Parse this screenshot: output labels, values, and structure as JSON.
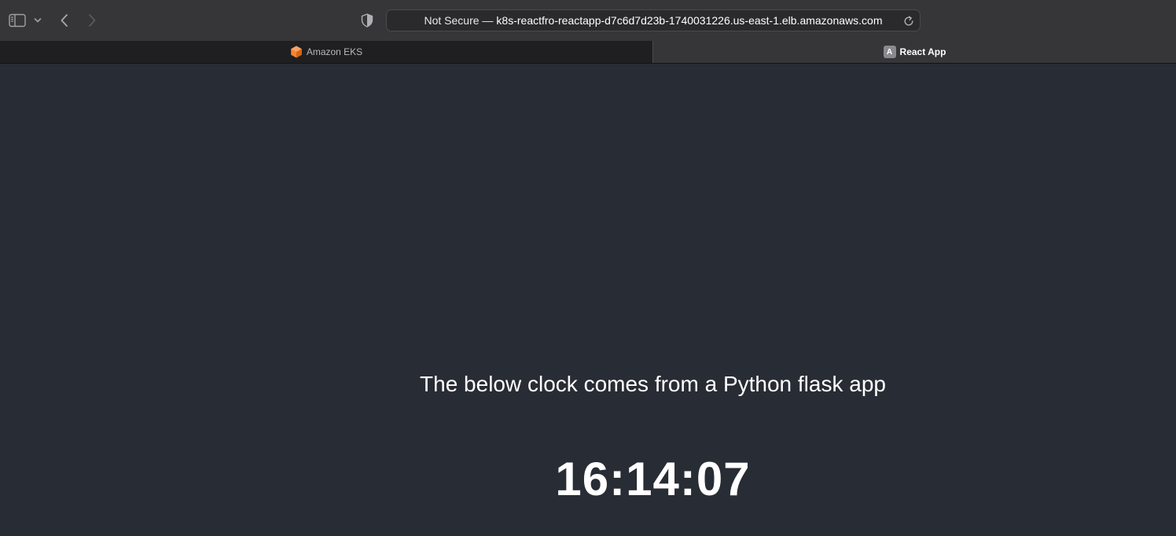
{
  "browser": {
    "address_bar": {
      "security_label": "Not Secure —",
      "url": "k8s-reactfro-reactapp-d7c6d7d23b-1740031226.us-east-1.elb.amazonaws.com"
    },
    "tabs": [
      {
        "title": "Amazon EKS",
        "icon": "aws-eks-icon",
        "active": false
      },
      {
        "title": "React App",
        "icon": "react-app-favicon",
        "favicon_letter": "A",
        "active": true
      }
    ],
    "icons": {
      "sidebar": "sidebar-icon",
      "chevron": "chevron-down-icon",
      "back": "chevron-left-icon",
      "forward": "chevron-right-icon",
      "privacy": "shield-icon",
      "reload": "reload-icon"
    }
  },
  "page": {
    "headline": "The below clock comes from a Python flask app",
    "clock_time": "16:14:07"
  },
  "colors": {
    "page_background": "#282c34",
    "toolbar": "#363638",
    "tabbar": "#1f1f21",
    "eks_orange": "#f58536"
  }
}
